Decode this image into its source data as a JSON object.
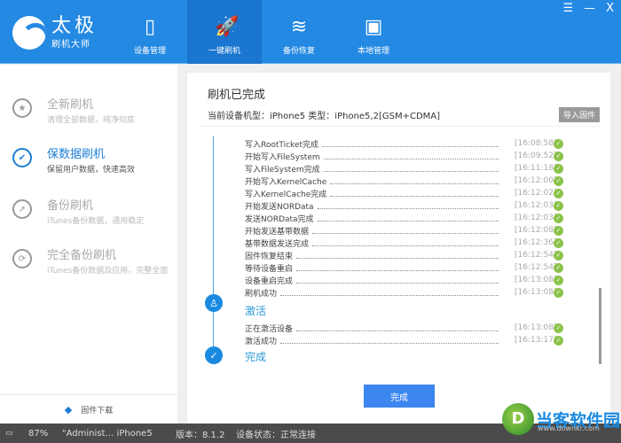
{
  "app": {
    "title": "太极",
    "subtitle": "刷机大师"
  },
  "window_controls": {
    "menu": "☰",
    "minimize": "—",
    "close": "X"
  },
  "nav": [
    {
      "label": "设备管理",
      "icon": "phone-icon"
    },
    {
      "label": "一键刷机",
      "icon": "rocket-icon",
      "active": true
    },
    {
      "label": "备份恢复",
      "icon": "database-icon"
    },
    {
      "label": "本地管理",
      "icon": "bag-icon"
    }
  ],
  "sidebar": {
    "items": [
      {
        "title": "全新刷机",
        "desc": "清理全部数据，纯净彻底",
        "icon": "star-icon"
      },
      {
        "title": "保数据刷机",
        "desc": "保留用户数据，快速高效",
        "icon": "check-icon",
        "active": true
      },
      {
        "title": "备份刷机",
        "desc": "iTunes备份数据，通用稳定",
        "icon": "compass-icon"
      },
      {
        "title": "完全备份刷机",
        "desc": "iTunes备份数据及应用，完整全面",
        "icon": "refresh-icon"
      }
    ],
    "firmware_download": "固件下载"
  },
  "main": {
    "title": "刷机已完成",
    "device_line": "当前设备机型：iPhone5 类型：iPhone5,2[GSM+CDMA]",
    "import_button": "导入固件",
    "log": [
      {
        "name": "写入RootTicket完成",
        "time": "[16:08:58]"
      },
      {
        "name": "开始写入FileSystem",
        "time": "[16:09:52]"
      },
      {
        "name": "写入FileSystem完成",
        "time": "[16:11:18]"
      },
      {
        "name": "开始写入KernelCache",
        "time": "[16:12:00]"
      },
      {
        "name": "写入KernelCache完成",
        "time": "[16:12:02]"
      },
      {
        "name": "开始发送NORData",
        "time": "[16:12:03]"
      },
      {
        "name": "发送NORData完成",
        "time": "[16:12:03]"
      },
      {
        "name": "开始发送基带数据",
        "time": "[16:12:08]"
      },
      {
        "name": "基带数据发送完成",
        "time": "[16:12:36]"
      },
      {
        "name": "固件恢复结束",
        "time": "[16:12:54]"
      },
      {
        "name": "等待设备重启",
        "time": "[16:12:54]"
      },
      {
        "name": "设备重启完成",
        "time": "[16:13:08]"
      },
      {
        "name": "刷机成功",
        "time": "[16:13:08]"
      }
    ],
    "stage_activate": "激活",
    "activate_log": [
      {
        "name": "正在激活设备",
        "time": "[16:13:08]"
      },
      {
        "name": "激活成功",
        "time": "[16:13:17]"
      }
    ],
    "stage_done": "完成",
    "done_button": "完成"
  },
  "status": {
    "battery": "87%",
    "user": "\"Administ… iPhone5",
    "version": "版本：8.1.2",
    "device_state": "设备状态：正常连接"
  },
  "watermark": {
    "text": "当客软件园",
    "url": "www.downkr.com"
  }
}
